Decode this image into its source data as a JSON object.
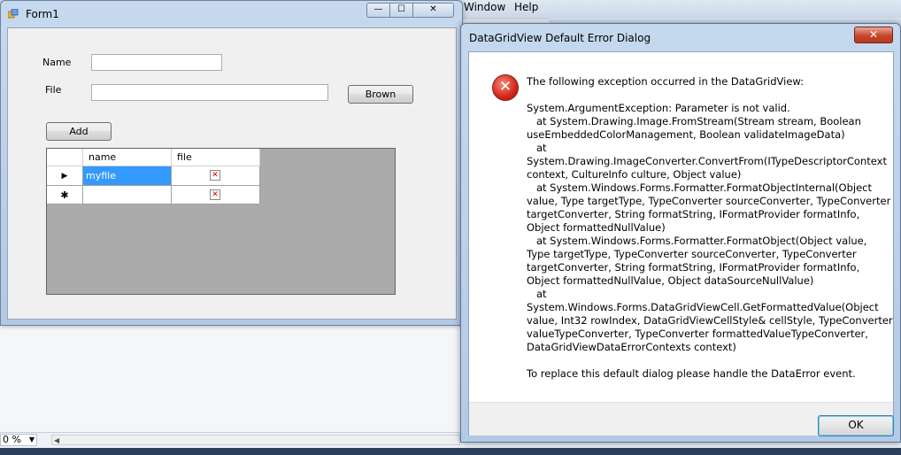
{
  "ide": {
    "menu_window": "Window",
    "menu_help": "Help",
    "zoom": "0 %"
  },
  "form1": {
    "title": "Form1",
    "name_label": "Name",
    "file_label": "File",
    "name_value": "",
    "file_value": "",
    "browse_button": "Brown",
    "add_button": "Add",
    "grid": {
      "columns": [
        "name",
        "file"
      ],
      "rows": [
        {
          "name": "myfile",
          "indicator": "▶"
        },
        {
          "name": "",
          "indicator": "✱"
        }
      ]
    },
    "minimize": "—",
    "maximize": "☐",
    "close": "✕"
  },
  "dialog": {
    "title": "DataGridView Default Error Dialog",
    "close": "✕",
    "icon": "error-icon",
    "message": "The following exception occurred in the DataGridView:\n\nSystem.ArgumentException: Parameter is not valid.\n   at System.Drawing.Image.FromStream(Stream stream, Boolean\nuseEmbeddedColorManagement, Boolean validateImageData)\n   at\nSystem.Drawing.ImageConverter.ConvertFrom(ITypeDescriptorContext\ncontext, CultureInfo culture, Object value)\n   at System.Windows.Forms.Formatter.FormatObjectInternal(Object\nvalue, Type targetType, TypeConverter sourceConverter, TypeConverter\ntargetConverter, String formatString, IFormatProvider formatInfo,\nObject formattedNullValue)\n   at System.Windows.Forms.Formatter.FormatObject(Object value,\nType targetType, TypeConverter sourceConverter, TypeConverter\ntargetConverter, String formatString, IFormatProvider formatInfo,\nObject formattedNullValue, Object dataSourceNullValue)\n   at\nSystem.Windows.Forms.DataGridViewCell.GetFormattedValue(Object\nvalue, Int32 rowIndex, DataGridViewCellStyle& cellStyle, TypeConverter\nvalueTypeConverter, TypeConverter formattedValueTypeConverter,\nDataGridViewDataErrorContexts context)\n\nTo replace this default dialog please handle the DataError event.",
    "ok_button": "OK"
  }
}
